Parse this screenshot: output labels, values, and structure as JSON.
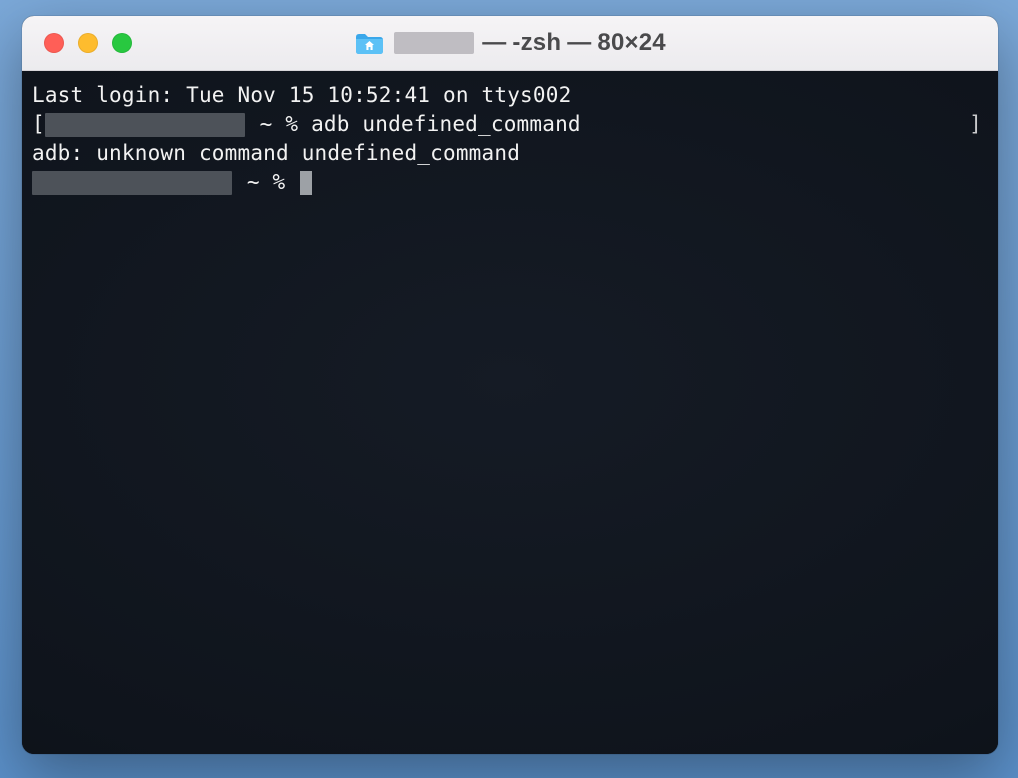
{
  "window": {
    "title_redacted": "████",
    "title_sep": " — ",
    "title_shell": "-zsh",
    "title_size": "80×24"
  },
  "terminal": {
    "last_login": "Last login: Tue Nov 15 10:52:41 on ttys002",
    "prompt_open": "[",
    "prompt_tail": " ~ % ",
    "cmd1": "adb undefined_command",
    "line1_end": "]",
    "output1": "adb: unknown command undefined_command",
    "prompt2_tail": " ~ % "
  }
}
